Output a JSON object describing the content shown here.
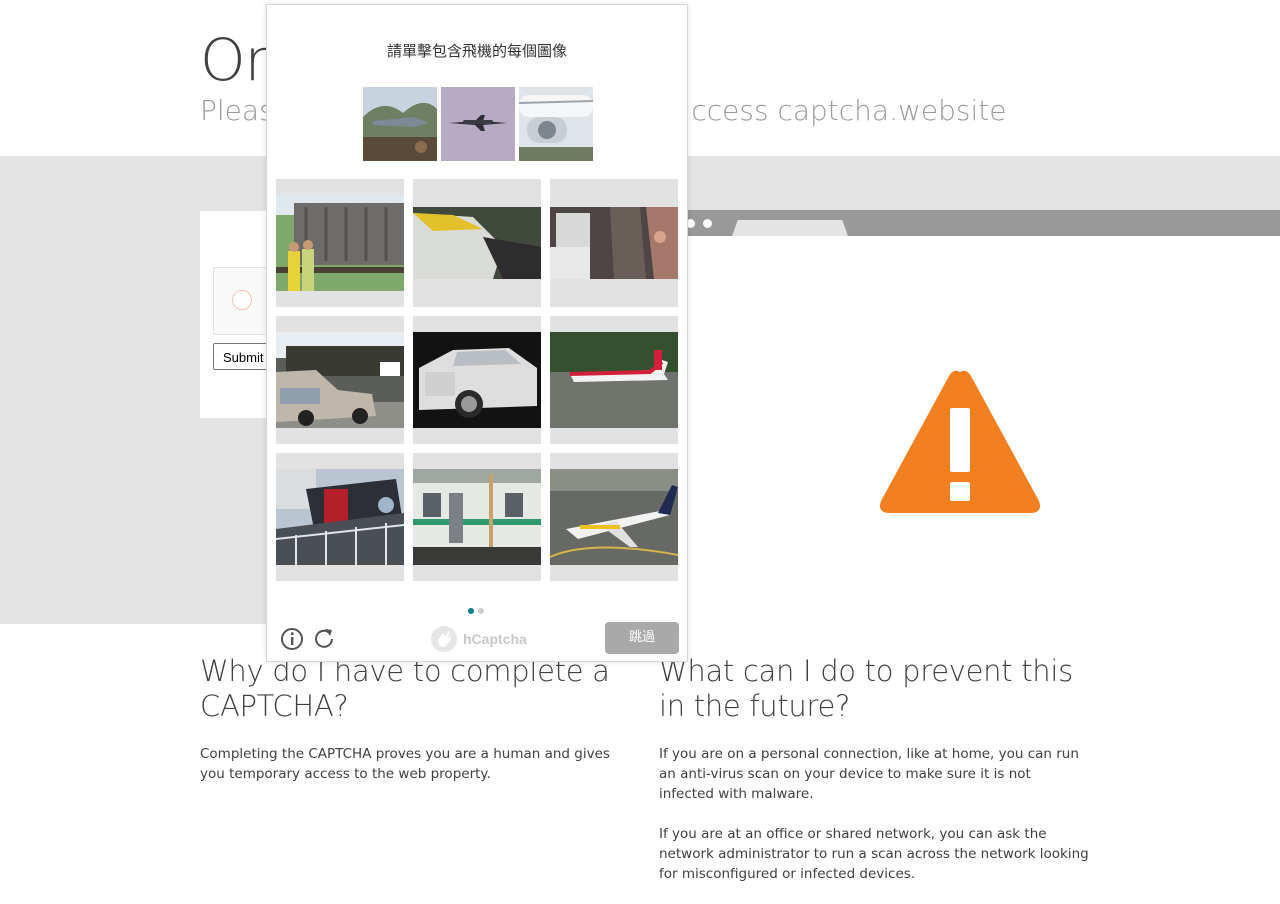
{
  "page": {
    "title": "On",
    "subtitle": "Please                                             ccess captcha.website",
    "submit_label": "Submit"
  },
  "sections": [
    {
      "heading": "Why do I have to complete a CAPTCHA?",
      "paragraphs": [
        "Completing the CAPTCHA proves you are a human and gives you temporary access to the web property."
      ]
    },
    {
      "heading": "What can I do to prevent this in the future?",
      "paragraphs": [
        "If you are on a personal connection, like at home, you can run an anti-virus scan on your device to make sure it is not infected with malware.",
        "If you are at an office or shared network, you can ask the network administrator to run a scan across the network looking for misconfigured or infected devices."
      ]
    }
  ],
  "captcha": {
    "prompt": "請單擊包含飛機的每個圖像",
    "brand": "hCaptcha",
    "skip_label": "跳過",
    "page_indicator": {
      "current": 1,
      "total": 2
    },
    "examples": [
      {
        "subject": "vintage-aircraft-photo"
      },
      {
        "subject": "airplane-in-sky-photo"
      },
      {
        "subject": "airliner-engine-photo"
      }
    ],
    "tiles": [
      {
        "subject": "train-with-people-photo"
      },
      {
        "subject": "yellow-vehicle-closeup-photo"
      },
      {
        "subject": "vehicle-interior-photo"
      },
      {
        "subject": "old-car-at-race-photo"
      },
      {
        "subject": "white-luxury-car-photo"
      },
      {
        "subject": "red-white-airplane-photo"
      },
      {
        "subject": "red-tram-station-photo"
      },
      {
        "subject": "commuter-train-photo"
      },
      {
        "subject": "lufthansa-airplane-photo"
      }
    ]
  },
  "colors": {
    "band": "#e4e4e4",
    "warning": "#f38020",
    "dot_active": "#00838f",
    "dot_inactive": "#d0d0d0",
    "skip_button": "#a9a9a9"
  }
}
